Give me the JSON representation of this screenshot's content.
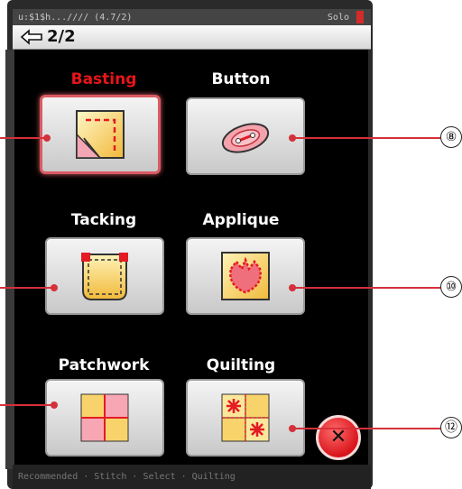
{
  "status_bar": {
    "left_text": "u:$1$h...////  (4.7/2)",
    "right_text": "Solo"
  },
  "header": {
    "page_indicator": "2/2"
  },
  "stitches": [
    {
      "label": "Basting",
      "selected": true,
      "callout": ""
    },
    {
      "label": "Button",
      "selected": false,
      "callout": "⑧"
    },
    {
      "label": "Tacking",
      "selected": false,
      "callout": ""
    },
    {
      "label": "Applique",
      "selected": false,
      "callout": "⑩"
    },
    {
      "label": "Patchwork",
      "selected": false,
      "callout": ""
    },
    {
      "label": "Quilting",
      "selected": false,
      "callout": "⑫"
    }
  ],
  "bottom_bar": {
    "text": "Recommended  ·  Stitch  ·  Select  ·  Quilting"
  },
  "colors": {
    "selected_label": "#e8141b",
    "callout_line": "#d4313a",
    "close_button": "#d8141b"
  },
  "icons": [
    "back-arrow-icon",
    "close-icon"
  ]
}
